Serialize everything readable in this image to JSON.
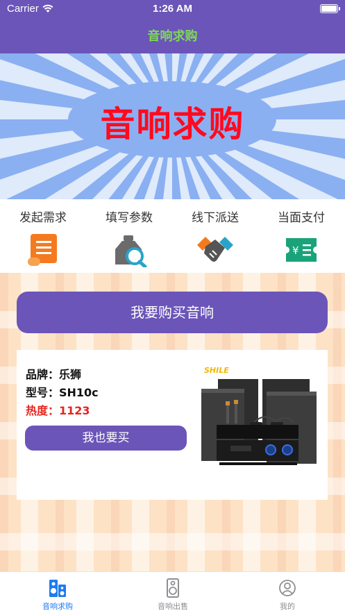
{
  "status_bar": {
    "carrier": "Carrier",
    "time": "1:26 AM"
  },
  "nav": {
    "title": "音响求购"
  },
  "banner": {
    "title": "音响求购"
  },
  "steps": [
    {
      "label": "发起需求",
      "icon": "scroll-icon"
    },
    {
      "label": "填写参数",
      "icon": "magnifier-icon"
    },
    {
      "label": "线下派送",
      "icon": "handshake-icon"
    },
    {
      "label": "当面支付",
      "icon": "payment-ticket-icon"
    }
  ],
  "buy_button": {
    "label": "我要购买音响"
  },
  "product": {
    "brand": "品牌：乐狮",
    "model": "型号：SH10c",
    "heat": "热度：1123",
    "button": "我也要买",
    "logo_text": "SHILE"
  },
  "tabbar": {
    "items": [
      {
        "label": "音响求购",
        "active": true
      },
      {
        "label": "音响出售",
        "active": false
      },
      {
        "label": "我的",
        "active": false
      }
    ]
  },
  "colors": {
    "primary": "#6b55b8",
    "nav_title": "#7ed957",
    "banner_title": "#ff0a1e",
    "heat": "#e8231d",
    "tab_active": "#1e7bf0"
  }
}
